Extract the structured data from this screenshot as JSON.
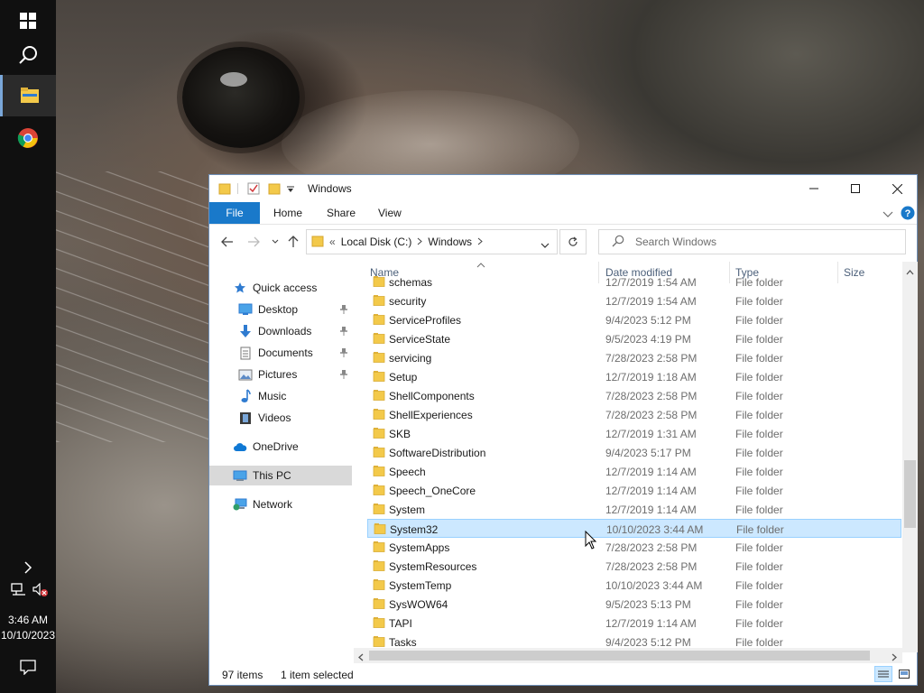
{
  "taskbar": {
    "items": [
      {
        "name": "start",
        "icon": "windows-logo-icon"
      },
      {
        "name": "search",
        "icon": "search-icon"
      },
      {
        "name": "file-explorer",
        "icon": "folder-icon",
        "active": true
      },
      {
        "name": "chrome",
        "icon": "chrome-icon"
      }
    ],
    "clock_time": "3:46 AM",
    "clock_date": "10/10/2023"
  },
  "window": {
    "title": "Windows",
    "ribbon_tabs": [
      "File",
      "Home",
      "Share",
      "View"
    ],
    "address": {
      "prefix": "«",
      "segments": [
        "Local Disk (C:)",
        "Windows"
      ]
    },
    "search_placeholder": "Search Windows",
    "columns": {
      "name": "Name",
      "date": "Date modified",
      "type": "Type",
      "size": "Size"
    },
    "nav_pane": {
      "quick_access": "Quick access",
      "pinned": [
        "Desktop",
        "Downloads",
        "Documents",
        "Pictures"
      ],
      "unpinned": [
        "Music",
        "Videos"
      ],
      "onedrive": "OneDrive",
      "this_pc": "This PC",
      "network": "Network"
    },
    "rows": [
      {
        "name": "schemas",
        "date": "12/7/2019 1:54 AM",
        "type": "File folder"
      },
      {
        "name": "security",
        "date": "12/7/2019 1:54 AM",
        "type": "File folder"
      },
      {
        "name": "ServiceProfiles",
        "date": "9/4/2023 5:12 PM",
        "type": "File folder"
      },
      {
        "name": "ServiceState",
        "date": "9/5/2023 4:19 PM",
        "type": "File folder"
      },
      {
        "name": "servicing",
        "date": "7/28/2023 2:58 PM",
        "type": "File folder"
      },
      {
        "name": "Setup",
        "date": "12/7/2019 1:18 AM",
        "type": "File folder"
      },
      {
        "name": "ShellComponents",
        "date": "7/28/2023 2:58 PM",
        "type": "File folder"
      },
      {
        "name": "ShellExperiences",
        "date": "7/28/2023 2:58 PM",
        "type": "File folder"
      },
      {
        "name": "SKB",
        "date": "12/7/2019 1:31 AM",
        "type": "File folder"
      },
      {
        "name": "SoftwareDistribution",
        "date": "9/4/2023 5:17 PM",
        "type": "File folder"
      },
      {
        "name": "Speech",
        "date": "12/7/2019 1:14 AM",
        "type": "File folder"
      },
      {
        "name": "Speech_OneCore",
        "date": "12/7/2019 1:14 AM",
        "type": "File folder"
      },
      {
        "name": "System",
        "date": "12/7/2019 1:14 AM",
        "type": "File folder"
      },
      {
        "name": "System32",
        "date": "10/10/2023 3:44 AM",
        "type": "File folder",
        "selected": true
      },
      {
        "name": "SystemApps",
        "date": "7/28/2023 2:58 PM",
        "type": "File folder"
      },
      {
        "name": "SystemResources",
        "date": "7/28/2023 2:58 PM",
        "type": "File folder"
      },
      {
        "name": "SystemTemp",
        "date": "10/10/2023 3:44 AM",
        "type": "File folder"
      },
      {
        "name": "SysWOW64",
        "date": "9/5/2023 5:13 PM",
        "type": "File folder"
      },
      {
        "name": "TAPI",
        "date": "12/7/2019 1:14 AM",
        "type": "File folder"
      },
      {
        "name": "Tasks",
        "date": "9/4/2023 5:12 PM",
        "type": "File folder"
      }
    ],
    "status": {
      "item_count": "97 items",
      "selection": "1 item selected"
    }
  },
  "colors": {
    "accent": "#1979ca",
    "selection_bg": "#cce8ff",
    "folder": "#f3c94a"
  }
}
